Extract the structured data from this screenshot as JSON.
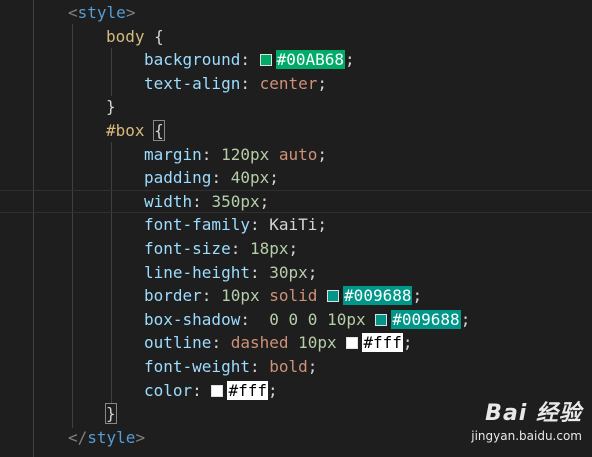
{
  "colors": {
    "background": "#1e1e1e",
    "tag": "#569cd6",
    "selector": "#d7ba7d",
    "property": "#9cdcfe",
    "number": "#b5cea8",
    "keyword": "#ce9178"
  },
  "lines": [
    {
      "parts": [
        {
          "t": "<",
          "c": "tag-punc"
        },
        {
          "t": "style",
          "c": "tag-name"
        },
        {
          "t": ">",
          "c": "tag-punc"
        }
      ]
    },
    {
      "parts": [
        {
          "t": "body",
          "c": "sel"
        },
        {
          "t": " {",
          "c": "brace"
        }
      ]
    },
    {
      "parts": [
        {
          "t": "background",
          "c": "prop"
        },
        {
          "t": ": ",
          "c": "colon"
        },
        {
          "swatch": "#00AB68"
        },
        {
          "t": "#00AB68",
          "c": "hex",
          "bg": "#00AB68"
        },
        {
          "t": ";",
          "c": "semi"
        }
      ]
    },
    {
      "parts": [
        {
          "t": "text-align",
          "c": "prop"
        },
        {
          "t": ": ",
          "c": "colon"
        },
        {
          "t": "center",
          "c": "kw"
        },
        {
          "t": ";",
          "c": "semi"
        }
      ]
    },
    {
      "parts": [
        {
          "t": "}",
          "c": "brace"
        }
      ]
    },
    {
      "parts": [
        {
          "t": "#box",
          "c": "sel"
        },
        {
          "t": " ",
          "c": "brace"
        },
        {
          "t": "{",
          "c": "brace brace-match"
        }
      ]
    },
    {
      "parts": [
        {
          "t": "margin",
          "c": "prop"
        },
        {
          "t": ": ",
          "c": "colon"
        },
        {
          "t": "120px",
          "c": "num"
        },
        {
          "t": " ",
          "c": "ident"
        },
        {
          "t": "auto",
          "c": "kw"
        },
        {
          "t": ";",
          "c": "semi"
        }
      ]
    },
    {
      "parts": [
        {
          "t": "padding",
          "c": "prop"
        },
        {
          "t": ": ",
          "c": "colon"
        },
        {
          "t": "40px",
          "c": "num"
        },
        {
          "t": ";",
          "c": "semi"
        }
      ]
    },
    {
      "parts": [
        {
          "t": "width",
          "c": "prop"
        },
        {
          "t": ": ",
          "c": "colon"
        },
        {
          "t": "350px",
          "c": "num"
        },
        {
          "t": ";",
          "c": "semi"
        }
      ]
    },
    {
      "parts": [
        {
          "t": "font-family",
          "c": "prop"
        },
        {
          "t": ": ",
          "c": "colon"
        },
        {
          "t": "KaiTi",
          "c": "ident"
        },
        {
          "t": ";",
          "c": "semi"
        }
      ]
    },
    {
      "parts": [
        {
          "t": "font-size",
          "c": "prop"
        },
        {
          "t": ": ",
          "c": "colon"
        },
        {
          "t": "18px",
          "c": "num"
        },
        {
          "t": ";",
          "c": "semi"
        }
      ]
    },
    {
      "parts": [
        {
          "t": "line-height",
          "c": "prop"
        },
        {
          "t": ": ",
          "c": "colon"
        },
        {
          "t": "30px",
          "c": "num"
        },
        {
          "t": ";",
          "c": "semi"
        }
      ]
    },
    {
      "parts": [
        {
          "t": "border",
          "c": "prop"
        },
        {
          "t": ": ",
          "c": "colon"
        },
        {
          "t": "10px",
          "c": "num"
        },
        {
          "t": " ",
          "c": "ident"
        },
        {
          "t": "solid",
          "c": "kw"
        },
        {
          "t": " ",
          "c": "ident"
        },
        {
          "swatch": "#009688"
        },
        {
          "t": "#009688",
          "c": "hex",
          "bg": "#009688"
        },
        {
          "t": ";",
          "c": "semi"
        }
      ]
    },
    {
      "parts": [
        {
          "t": "box-shadow",
          "c": "prop"
        },
        {
          "t": ":  ",
          "c": "colon"
        },
        {
          "t": "0",
          "c": "num"
        },
        {
          "t": " ",
          "c": "ident"
        },
        {
          "t": "0",
          "c": "num"
        },
        {
          "t": " ",
          "c": "ident"
        },
        {
          "t": "0",
          "c": "num"
        },
        {
          "t": " ",
          "c": "ident"
        },
        {
          "t": "10px",
          "c": "num"
        },
        {
          "t": " ",
          "c": "ident"
        },
        {
          "swatch": "#009688"
        },
        {
          "t": "#009688",
          "c": "hex",
          "bg": "#009688"
        },
        {
          "t": ";",
          "c": "semi"
        }
      ]
    },
    {
      "parts": [
        {
          "t": "outline",
          "c": "prop"
        },
        {
          "t": ": ",
          "c": "colon"
        },
        {
          "t": "dashed",
          "c": "kw"
        },
        {
          "t": " ",
          "c": "ident"
        },
        {
          "t": "10px",
          "c": "num"
        },
        {
          "t": " ",
          "c": "ident"
        },
        {
          "swatch": "#ffffff"
        },
        {
          "t": "#fff",
          "c": "hex light",
          "bg": "#ffffff"
        },
        {
          "t": ";",
          "c": "semi"
        }
      ]
    },
    {
      "parts": [
        {
          "t": "font-weight",
          "c": "prop"
        },
        {
          "t": ": ",
          "c": "colon"
        },
        {
          "t": "bold",
          "c": "kw"
        },
        {
          "t": ";",
          "c": "semi"
        }
      ]
    },
    {
      "parts": [
        {
          "t": "color",
          "c": "prop"
        },
        {
          "t": ": ",
          "c": "colon"
        },
        {
          "swatch": "#ffffff"
        },
        {
          "t": "#fff",
          "c": "hex light",
          "bg": "#ffffff"
        },
        {
          "t": ";",
          "c": "semi"
        }
      ]
    },
    {
      "parts": [
        {
          "t": "}",
          "c": "brace brace-match"
        }
      ]
    },
    {
      "parts": [
        {
          "t": "</",
          "c": "tag-punc"
        },
        {
          "t": "style",
          "c": "tag-name"
        },
        {
          "t": ">",
          "c": "tag-punc"
        }
      ]
    }
  ],
  "watermark": {
    "brand": "Bai 经验",
    "url": "jingyan.baidu.com"
  }
}
